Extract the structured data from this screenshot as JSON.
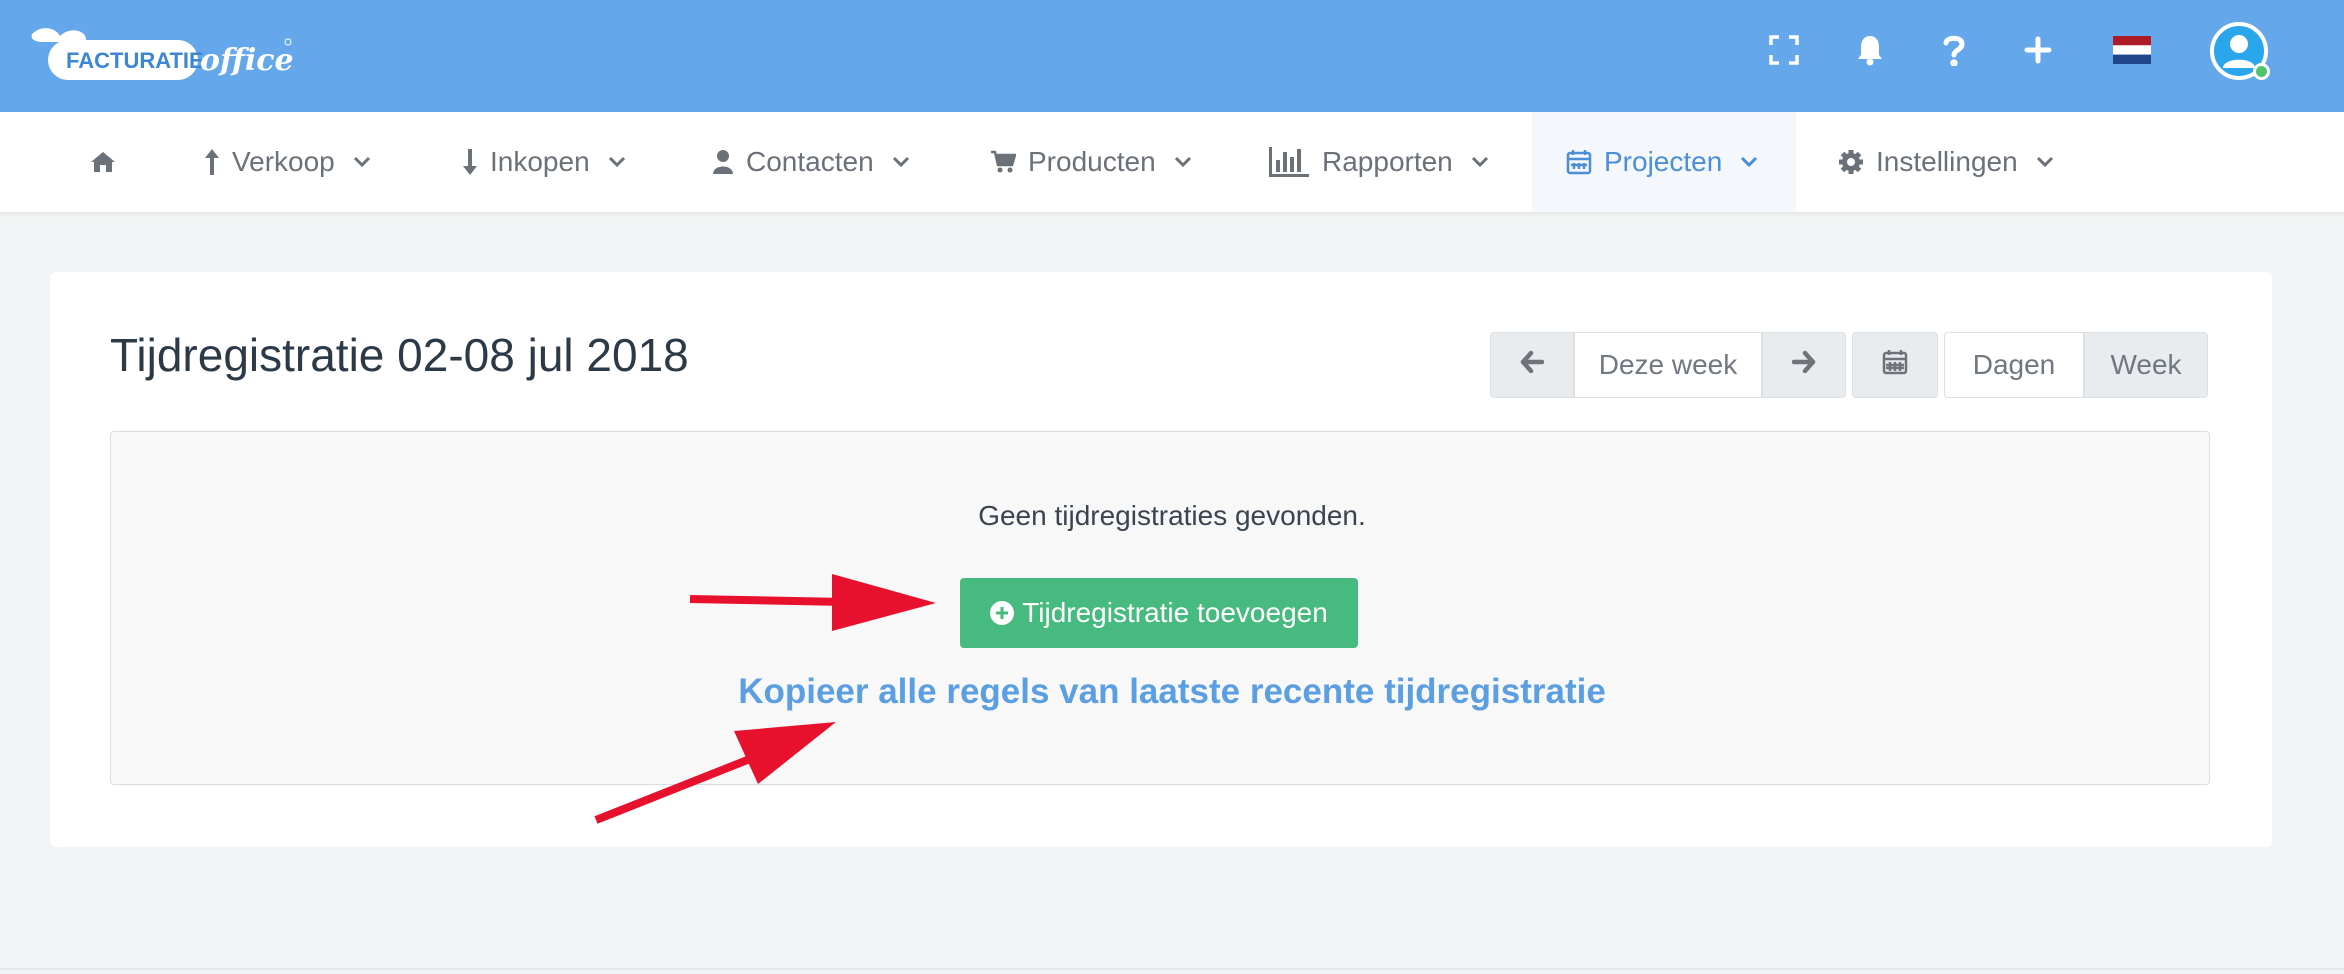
{
  "header": {
    "logo_text": "FACTURATIE",
    "logo_script": "office",
    "icons": [
      "fullscreen-icon",
      "bell-icon",
      "question-icon",
      "plus-icon",
      "dutch-flag-icon",
      "user-avatar-icon"
    ],
    "brand_color": "#64a7ea"
  },
  "nav": {
    "items": [
      {
        "label": "",
        "icon": "home-icon"
      },
      {
        "label": "Verkoop",
        "icon": "arrow-up-icon"
      },
      {
        "label": "Inkopen",
        "icon": "arrow-down-icon"
      },
      {
        "label": "Contacten",
        "icon": "user-icon"
      },
      {
        "label": "Producten",
        "icon": "cart-icon"
      },
      {
        "label": "Rapporten",
        "icon": "bar-chart-icon"
      },
      {
        "label": "Projecten",
        "icon": "calendar-icon",
        "active": true
      },
      {
        "label": "Instellingen",
        "icon": "gear-icon"
      }
    ]
  },
  "page": {
    "title": "Tijdregistratie 02-08 jul 2018",
    "week_nav": {
      "prev_icon": "arrow-left-icon",
      "current_label": "Deze week",
      "next_icon": "arrow-right-icon",
      "calendar_icon": "calendar-icon"
    },
    "view_toggle": {
      "days_label": "Dagen",
      "week_label": "Week",
      "selected": "Week"
    },
    "empty_state": {
      "message": "Geen tijdregistraties gevonden.",
      "add_button_label": "Tijdregistratie toevoegen",
      "copy_link_label": "Kopieer alle regels van laatste recente tijdregistratie"
    }
  },
  "colors": {
    "accent": "#5b9fe2",
    "success": "#47ba7f",
    "annotation_arrow": "#e8112d"
  }
}
